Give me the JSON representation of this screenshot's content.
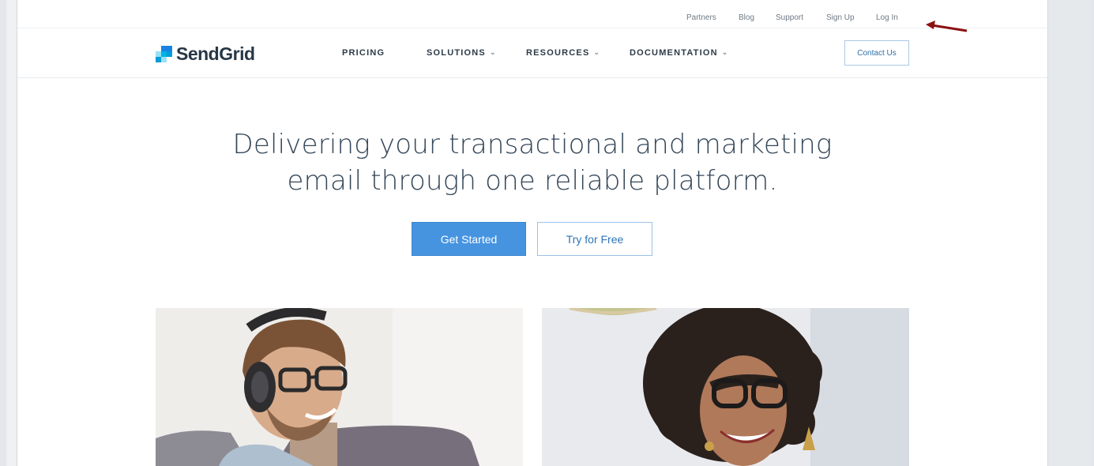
{
  "utility_nav": [
    "Partners",
    "Blog",
    "Support",
    "Sign Up",
    "Log In"
  ],
  "brand": {
    "name": "SendGrid"
  },
  "main_nav": {
    "items": [
      {
        "label": "PRICING",
        "has_dropdown": false
      },
      {
        "label": "SOLUTIONS",
        "has_dropdown": true
      },
      {
        "label": "RESOURCES",
        "has_dropdown": true
      },
      {
        "label": "DOCUMENTATION",
        "has_dropdown": true
      }
    ],
    "contact_label": "Contact Us"
  },
  "hero": {
    "title_line1": "Delivering your transactional and marketing",
    "title_line2": "email through one reliable platform.",
    "primary_cta": "Get Started",
    "secondary_cta": "Try for Free"
  },
  "icons": [
    "chevron-down-icon",
    "arrow-annotation-icon"
  ],
  "colors": {
    "primary": "#4694e0",
    "text_dark": "#263746",
    "link": "#2f74b5",
    "annotation_arrow": "#8b1111"
  }
}
